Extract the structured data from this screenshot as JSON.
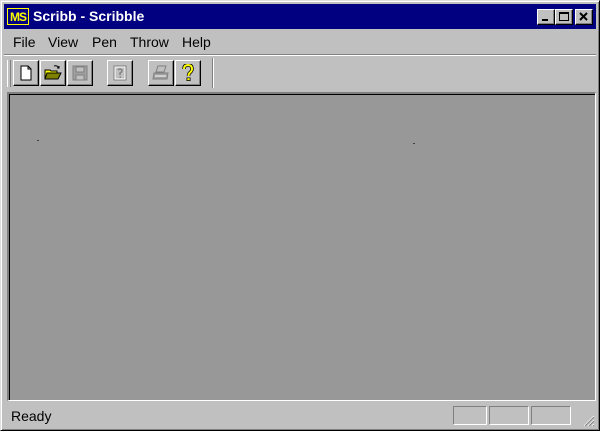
{
  "window": {
    "icon_text": "MS",
    "title": "Scribb - Scribble"
  },
  "menubar": {
    "items": [
      {
        "label": "File"
      },
      {
        "label": "View"
      },
      {
        "label": "Pen"
      },
      {
        "label": "Throw"
      },
      {
        "label": "Help"
      }
    ]
  },
  "toolbar": {
    "buttons": [
      {
        "icon": "new-document-icon",
        "enabled": true
      },
      {
        "icon": "open-folder-icon",
        "enabled": true
      },
      {
        "icon": "save-disk-icon",
        "enabled": false
      },
      {
        "icon": "context-help-icon",
        "enabled": false
      },
      {
        "icon": "print-icon",
        "enabled": false
      },
      {
        "icon": "help-question-icon",
        "enabled": true
      }
    ]
  },
  "statusbar": {
    "text": "Ready",
    "indicators": [
      "",
      "",
      ""
    ]
  },
  "colors": {
    "title_bar": "#000080",
    "face": "#c0c0c0",
    "canvas": "#989898",
    "icon_yellow": "#ffff00"
  }
}
